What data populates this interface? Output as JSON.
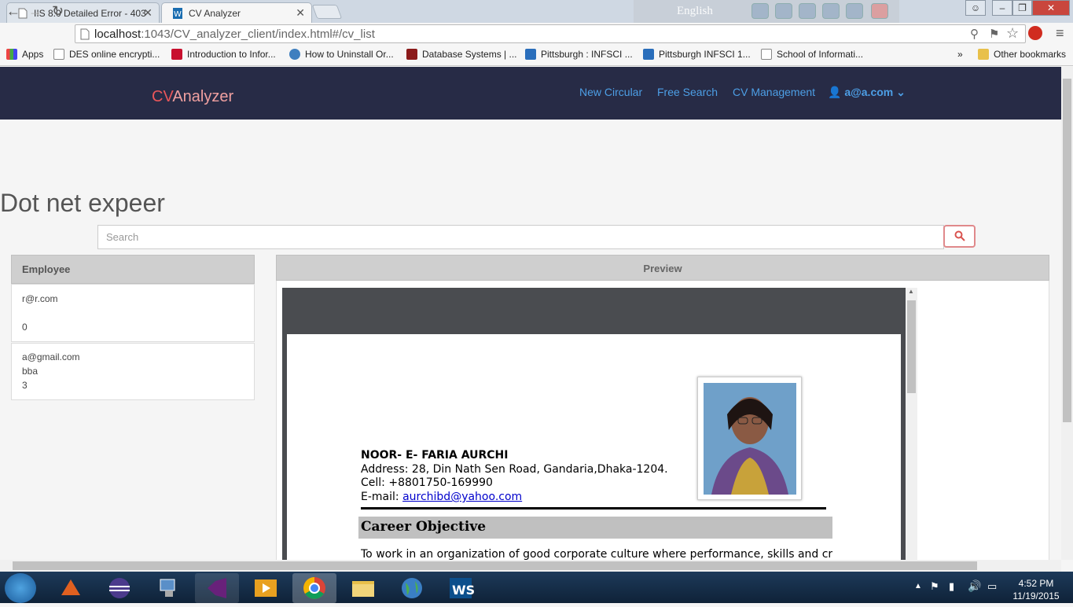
{
  "browser": {
    "tabs": [
      {
        "title": "IIS 8.0 Detailed Error - 403"
      },
      {
        "title": "CV Analyzer"
      }
    ],
    "address": {
      "host": "localhost",
      "path": ":1043/CV_analyzer_client/index.html#/cv_list"
    },
    "translate_label": "English",
    "bookmarks": [
      {
        "label": "Apps"
      },
      {
        "label": "DES online encrypti..."
      },
      {
        "label": "Introduction to Infor..."
      },
      {
        "label": "How to Uninstall Or..."
      },
      {
        "label": "Database Systems | ..."
      },
      {
        "label": "Pittsburgh : INFSCI ..."
      },
      {
        "label": "Pittsburgh INFSCI 1..."
      },
      {
        "label": "School of Informati..."
      }
    ],
    "bookmarks_more": "»",
    "other_bookmarks": "Other bookmarks"
  },
  "app": {
    "brand_cv": "CV",
    "brand_rest": "Analyzer",
    "nav": [
      "New Circular",
      "Free Search",
      "CV Management"
    ],
    "user": "a@a.com",
    "page_title": "Dot net expeer",
    "search_placeholder": "Search",
    "employee_header": "Employee",
    "employees": [
      {
        "email": "r@r.com",
        "field2": "",
        "score": "0"
      },
      {
        "email": "a@gmail.com",
        "field2": "bba",
        "score": "3"
      }
    ],
    "preview_header": "Preview"
  },
  "document": {
    "name": "NOOR- E- FARIA AURCHI",
    "address": "Address: 28, Din Nath Sen Road, Gandaria,Dhaka-1204.",
    "cell": "Cell: +8801750-169990",
    "email_label": "E-mail: ",
    "email": "aurchibd@yahoo.com",
    "section_title": "Career Objective",
    "objective_text": "To work in an organization of good corporate culture where performance, skills and creativity"
  },
  "taskbar": {
    "time": "4:52 PM",
    "date": "11/19/2015"
  },
  "colors": {
    "navbar": "#272b46",
    "brand_accent": "#e9565a",
    "nav_link": "#4d9fe6"
  }
}
